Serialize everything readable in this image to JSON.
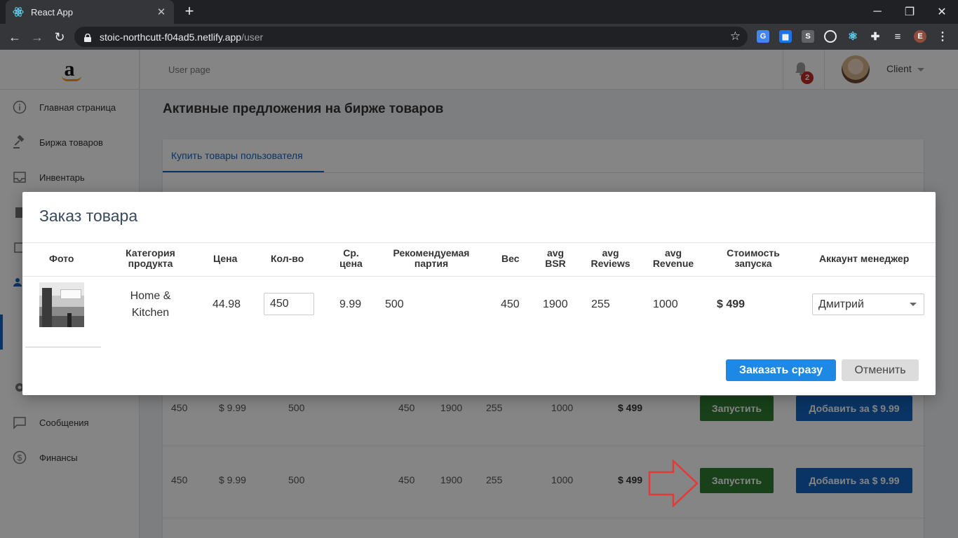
{
  "browser": {
    "tab_title": "React App",
    "url_host": "stoic-northcutt-f04ad5.netlify.app",
    "url_path": "/user",
    "profile_initial": "E"
  },
  "sidebar": {
    "items": [
      {
        "label": "Главная страница",
        "icon": "info-icon"
      },
      {
        "label": "Биржа товаров",
        "icon": "gavel-icon"
      },
      {
        "label": "Инвентарь",
        "icon": "inbox-icon"
      },
      {
        "label": "Сообщения",
        "icon": "message-icon"
      },
      {
        "label": "Финансы",
        "icon": "dollar-icon"
      }
    ]
  },
  "header": {
    "breadcrumb": "User page",
    "notification_count": "2",
    "user_name": "Client"
  },
  "page": {
    "title": "Активные предложения на бирже товаров",
    "tab": "Купить товары пользователя",
    "rows": [
      {
        "qty": "450",
        "avg_price": "$ 9.99",
        "batch": "500",
        "weight": "450",
        "bsr": "1900",
        "reviews": "255",
        "revenue": "1000",
        "cost": "$ 499",
        "launch": "Запустить",
        "add": "Добавить за $ 9.99"
      },
      {
        "qty": "450",
        "avg_price": "$ 9.99",
        "batch": "500",
        "weight": "450",
        "bsr": "1900",
        "reviews": "255",
        "revenue": "1000",
        "cost": "$ 499",
        "launch": "Запустить",
        "add": "Добавить за $ 9.99"
      }
    ]
  },
  "modal": {
    "title": "Заказ товара",
    "headers": {
      "photo": "Фото",
      "category_1": "Категория",
      "category_2": "продукта",
      "price": "Цена",
      "qty": "Кол-во",
      "avg_1": "Ср.",
      "avg_2": "цена",
      "batch_1": "Рекомендуемая",
      "batch_2": "партия",
      "weight": "Вес",
      "bsr_1": "avg",
      "bsr_2": "BSR",
      "reviews_1": "avg",
      "reviews_2": "Reviews",
      "revenue_1": "avg",
      "revenue_2": "Revenue",
      "cost_1": "Стоимость",
      "cost_2": "запуска",
      "manager": "Аккаунт менеджер"
    },
    "row": {
      "category_1": "Home &",
      "category_2": "Kitchen",
      "price": "44.98",
      "qty": "450",
      "avg_price": "9.99",
      "batch": "500",
      "weight": "450",
      "bsr": "1900",
      "reviews": "255",
      "revenue": "1000",
      "cost": "$ 499",
      "manager": "Дмитрий"
    },
    "buttons": {
      "order": "Заказать сразу",
      "cancel": "Отменить"
    }
  }
}
